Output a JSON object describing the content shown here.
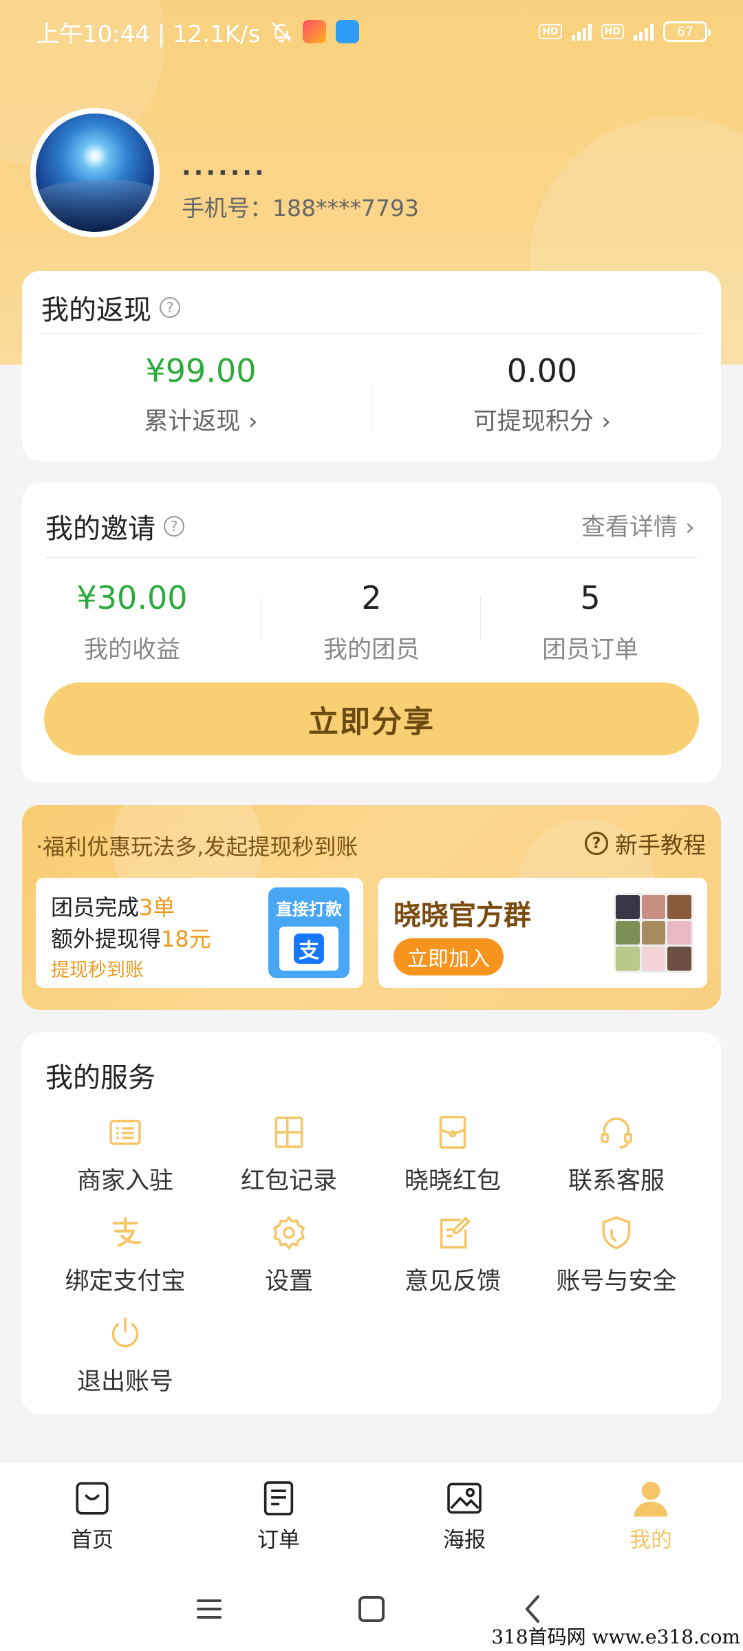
{
  "status_bar": {
    "time_speed": "上午10:44 | 12.1K/s",
    "battery": "67"
  },
  "profile": {
    "name": ".......",
    "phone": "手机号：188****7793"
  },
  "cashback": {
    "title": "我的返现",
    "total_value": "¥99.00",
    "total_label": "累计返现",
    "points_value": "0.00",
    "points_label": "可提现积分"
  },
  "invite": {
    "title": "我的邀请",
    "details_link": "查看详情",
    "earnings_value": "¥30.00",
    "earnings_label": "我的收益",
    "members_value": "2",
    "members_label": "我的团员",
    "orders_value": "5",
    "orders_label": "团员订单",
    "share_button": "立即分享"
  },
  "promo": {
    "tagline": "·福利优惠玩法多,发起提现秒到账",
    "tutorial": "新手教程",
    "task_line1_prefix": "团员完成",
    "task_line1_highlight": "3单",
    "task_line2_prefix": "额外提现得",
    "task_line2_highlight": "18元",
    "task_line3": "提现秒到账",
    "alipay_badge": "直接打款",
    "group_title": "晓晓官方群",
    "join_button": "立即加入"
  },
  "services": {
    "title": "我的服务",
    "items": [
      {
        "label": "商家入驻",
        "icon": "merchant-icon"
      },
      {
        "label": "红包记录",
        "icon": "grid-icon"
      },
      {
        "label": "晓晓红包",
        "icon": "red-packet-icon"
      },
      {
        "label": "联系客服",
        "icon": "headset-icon"
      },
      {
        "label": "绑定支付宝",
        "icon": "alipay-icon"
      },
      {
        "label": "设置",
        "icon": "gear-icon"
      },
      {
        "label": "意见反馈",
        "icon": "edit-icon"
      },
      {
        "label": "账号与安全",
        "icon": "shield-icon"
      },
      {
        "label": "退出账号",
        "icon": "power-icon"
      }
    ]
  },
  "tabbar": {
    "items": [
      {
        "label": "首页",
        "icon": "shopping-bag-icon"
      },
      {
        "label": "订单",
        "icon": "order-list-icon"
      },
      {
        "label": "海报",
        "icon": "image-icon"
      },
      {
        "label": "我的",
        "icon": "user-icon"
      }
    ],
    "active_index": 3
  },
  "watermark": "318首码网  www.e318.com",
  "colors": {
    "accent": "#f9cf74",
    "green": "#2bab3b",
    "orange": "#f7941d",
    "icon": "#f5c566"
  }
}
